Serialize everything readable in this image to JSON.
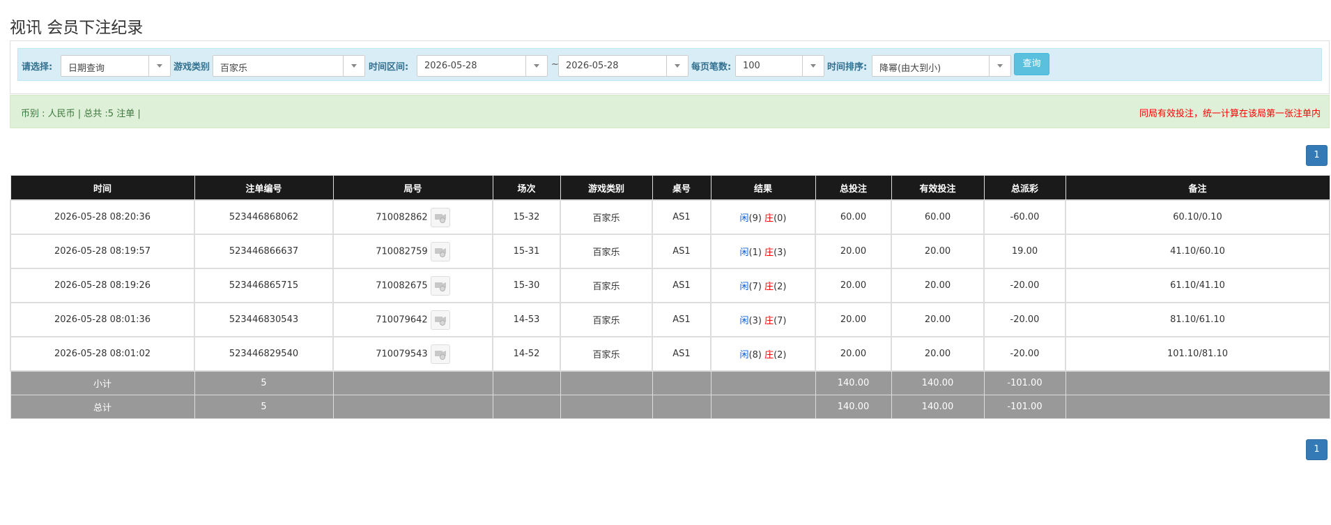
{
  "page": {
    "title": "视讯 会员下注纪录"
  },
  "filters": {
    "select_label": "请选择:",
    "select_value": "日期查询",
    "game_type_label": "游戏类别",
    "game_type_value": "百家乐",
    "time_range_label": "时间区间:",
    "start_date": "2026-05-28",
    "range_sep": "~",
    "end_date": "2026-05-28",
    "per_page_label": "每页笔数:",
    "per_page_value": "100",
    "sort_label": "时间排序:",
    "sort_value": "降幂(由大到小)",
    "query_button": "查询"
  },
  "summary": {
    "left": "币别 : 人民币 | 总共 :5 注单 |",
    "right": "同局有效投注，统一计算在该局第一张注单内"
  },
  "pagination": {
    "current": "1"
  },
  "table": {
    "headers": [
      "时间",
      "注单编号",
      "局号",
      "场次",
      "游戏类别",
      "桌号",
      "结果",
      "总投注",
      "有效投注",
      "总派彩",
      "备注"
    ],
    "rows": [
      {
        "time": "2026-05-28 08:20:36",
        "bet_no": "523446868062",
        "round_no": "710082862",
        "session": "15-32",
        "game": "百家乐",
        "table": "AS1",
        "player_label": "闲",
        "player_val": "(9)",
        "banker_label": "庄",
        "banker_val": "(0)",
        "total_bet": "60.00",
        "valid_bet": "60.00",
        "payout": "-60.00",
        "payout_negative": true,
        "note": "60.10/0.10"
      },
      {
        "time": "2026-05-28 08:19:57",
        "bet_no": "523446866637",
        "round_no": "710082759",
        "session": "15-31",
        "game": "百家乐",
        "table": "AS1",
        "player_label": "闲",
        "player_val": "(1)",
        "banker_label": "庄",
        "banker_val": "(3)",
        "total_bet": "20.00",
        "valid_bet": "20.00",
        "payout": "19.00",
        "payout_negative": false,
        "note": "41.10/60.10"
      },
      {
        "time": "2026-05-28 08:19:26",
        "bet_no": "523446865715",
        "round_no": "710082675",
        "session": "15-30",
        "game": "百家乐",
        "table": "AS1",
        "player_label": "闲",
        "player_val": "(7)",
        "banker_label": "庄",
        "banker_val": "(2)",
        "total_bet": "20.00",
        "valid_bet": "20.00",
        "payout": "-20.00",
        "payout_negative": true,
        "note": "61.10/41.10"
      },
      {
        "time": "2026-05-28 08:01:36",
        "bet_no": "523446830543",
        "round_no": "710079642",
        "session": "14-53",
        "game": "百家乐",
        "table": "AS1",
        "player_label": "闲",
        "player_val": "(3)",
        "banker_label": "庄",
        "banker_val": "(7)",
        "total_bet": "20.00",
        "valid_bet": "20.00",
        "payout": "-20.00",
        "payout_negative": true,
        "note": "81.10/61.10"
      },
      {
        "time": "2026-05-28 08:01:02",
        "bet_no": "523446829540",
        "round_no": "710079543",
        "session": "14-52",
        "game": "百家乐",
        "table": "AS1",
        "player_label": "闲",
        "player_val": "(8)",
        "banker_label": "庄",
        "banker_val": "(2)",
        "total_bet": "20.00",
        "valid_bet": "20.00",
        "payout": "-20.00",
        "payout_negative": true,
        "note": "101.10/81.10"
      }
    ],
    "subtotal": {
      "label": "小计",
      "count": "5",
      "total_bet": "140.00",
      "valid_bet": "140.00",
      "payout": "-101.00"
    },
    "grand_total": {
      "label": "总计",
      "count": "5",
      "total_bet": "140.00",
      "valid_bet": "140.00",
      "payout": "-101.00"
    }
  }
}
